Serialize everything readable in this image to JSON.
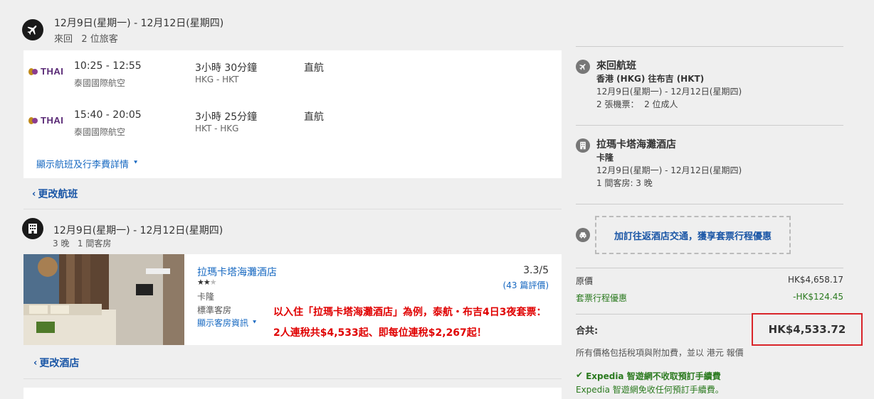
{
  "flight_section": {
    "dates": "12月9日(星期一) - 12月12日(星期四)",
    "subtitle": "來回   2 位旅客",
    "legs": [
      {
        "logo": "THAI",
        "time": "10:25 - 12:55",
        "airline": "泰國國際航空",
        "duration": "3小時 30分鐘",
        "route": "HKG - HKT",
        "stops": "直航"
      },
      {
        "logo": "THAI",
        "time": "15:40 - 20:05",
        "airline": "泰國國際航空",
        "duration": "3小時 25分鐘",
        "route": "HKT - HKG",
        "stops": "直航"
      }
    ],
    "details_link": "顯示航班及行李費詳情",
    "change_link": "更改航班"
  },
  "hotel_section": {
    "dates": "12月9日(星期一) - 12月12日(星期四)",
    "subtitle": "3 晚   1 間客房",
    "name": "拉瑪卡塔海灘酒店",
    "stars": "★★",
    "half_star": "★",
    "location": "卡隆",
    "room_type": "標準客房",
    "room_info_link": "顯示客房資訊",
    "rating": "3.3/5",
    "reviews": "(43 篇評價)",
    "change_link": "更改酒店"
  },
  "annotation": {
    "line1": "以入住「拉瑪卡塔海灘酒店」為例，泰航・布吉4日3夜套票：",
    "line2": "2人連稅共$4,533起、即每位連稅$2,267起！"
  },
  "sidebar": {
    "flight": {
      "title": "來回航班",
      "route": "香港 (HKG) 往布吉 (HKT)",
      "dates": "12月9日(星期一) - 12月12日(星期四)",
      "tickets": "2 張機票：  2 位成人"
    },
    "hotel": {
      "title": "拉瑪卡塔海灘酒店",
      "location": "卡隆",
      "dates": "12月9日(星期一) - 12月12日(星期四)",
      "rooms": "1 間客房: 3 晚"
    },
    "transfer_promo": "加訂往返酒店交通，獲享套票行程優惠",
    "prices": {
      "original_label": "原價",
      "original_value": "HK$4,658.17",
      "discount_label": "套票行程優惠",
      "discount_value": "-HK$124.45",
      "total_label": "合共:",
      "total_value": "HK$4,533.72",
      "note": "所有價格包括稅項與附加費，並以 港元 報價"
    },
    "fee": {
      "title": "Expedia 智遊網不收取預訂手續費",
      "text": "Expedia 智遊網免收任何預訂手續費。"
    }
  },
  "colors": {
    "link": "#1668c1",
    "discount": "#2b7a1f",
    "highlight_border": "#d9252a",
    "annotation": "#e00000"
  }
}
